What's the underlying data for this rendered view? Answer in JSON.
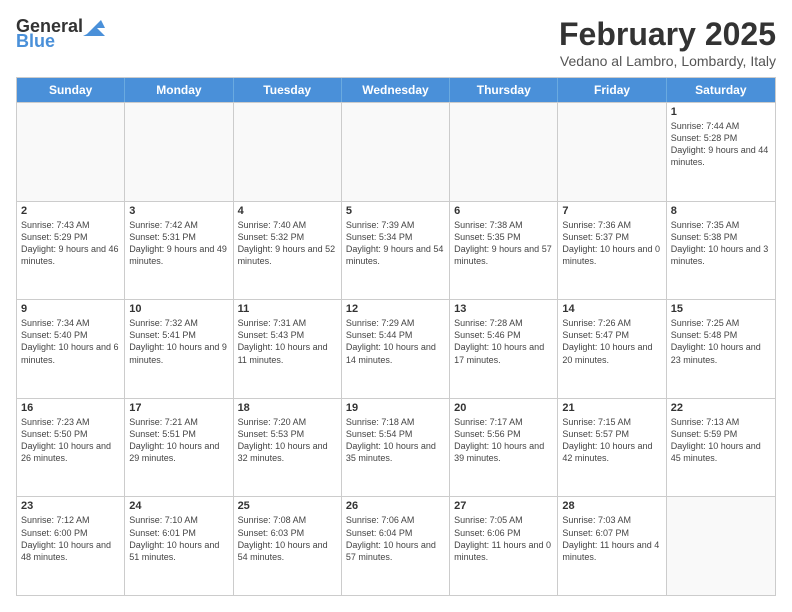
{
  "logo": {
    "general": "General",
    "blue": "Blue"
  },
  "header": {
    "month": "February 2025",
    "location": "Vedano al Lambro, Lombardy, Italy"
  },
  "days_of_week": [
    "Sunday",
    "Monday",
    "Tuesday",
    "Wednesday",
    "Thursday",
    "Friday",
    "Saturday"
  ],
  "weeks": [
    [
      {
        "day": "",
        "info": ""
      },
      {
        "day": "",
        "info": ""
      },
      {
        "day": "",
        "info": ""
      },
      {
        "day": "",
        "info": ""
      },
      {
        "day": "",
        "info": ""
      },
      {
        "day": "",
        "info": ""
      },
      {
        "day": "1",
        "info": "Sunrise: 7:44 AM\nSunset: 5:28 PM\nDaylight: 9 hours and 44 minutes."
      }
    ],
    [
      {
        "day": "2",
        "info": "Sunrise: 7:43 AM\nSunset: 5:29 PM\nDaylight: 9 hours and 46 minutes."
      },
      {
        "day": "3",
        "info": "Sunrise: 7:42 AM\nSunset: 5:31 PM\nDaylight: 9 hours and 49 minutes."
      },
      {
        "day": "4",
        "info": "Sunrise: 7:40 AM\nSunset: 5:32 PM\nDaylight: 9 hours and 52 minutes."
      },
      {
        "day": "5",
        "info": "Sunrise: 7:39 AM\nSunset: 5:34 PM\nDaylight: 9 hours and 54 minutes."
      },
      {
        "day": "6",
        "info": "Sunrise: 7:38 AM\nSunset: 5:35 PM\nDaylight: 9 hours and 57 minutes."
      },
      {
        "day": "7",
        "info": "Sunrise: 7:36 AM\nSunset: 5:37 PM\nDaylight: 10 hours and 0 minutes."
      },
      {
        "day": "8",
        "info": "Sunrise: 7:35 AM\nSunset: 5:38 PM\nDaylight: 10 hours and 3 minutes."
      }
    ],
    [
      {
        "day": "9",
        "info": "Sunrise: 7:34 AM\nSunset: 5:40 PM\nDaylight: 10 hours and 6 minutes."
      },
      {
        "day": "10",
        "info": "Sunrise: 7:32 AM\nSunset: 5:41 PM\nDaylight: 10 hours and 9 minutes."
      },
      {
        "day": "11",
        "info": "Sunrise: 7:31 AM\nSunset: 5:43 PM\nDaylight: 10 hours and 11 minutes."
      },
      {
        "day": "12",
        "info": "Sunrise: 7:29 AM\nSunset: 5:44 PM\nDaylight: 10 hours and 14 minutes."
      },
      {
        "day": "13",
        "info": "Sunrise: 7:28 AM\nSunset: 5:46 PM\nDaylight: 10 hours and 17 minutes."
      },
      {
        "day": "14",
        "info": "Sunrise: 7:26 AM\nSunset: 5:47 PM\nDaylight: 10 hours and 20 minutes."
      },
      {
        "day": "15",
        "info": "Sunrise: 7:25 AM\nSunset: 5:48 PM\nDaylight: 10 hours and 23 minutes."
      }
    ],
    [
      {
        "day": "16",
        "info": "Sunrise: 7:23 AM\nSunset: 5:50 PM\nDaylight: 10 hours and 26 minutes."
      },
      {
        "day": "17",
        "info": "Sunrise: 7:21 AM\nSunset: 5:51 PM\nDaylight: 10 hours and 29 minutes."
      },
      {
        "day": "18",
        "info": "Sunrise: 7:20 AM\nSunset: 5:53 PM\nDaylight: 10 hours and 32 minutes."
      },
      {
        "day": "19",
        "info": "Sunrise: 7:18 AM\nSunset: 5:54 PM\nDaylight: 10 hours and 35 minutes."
      },
      {
        "day": "20",
        "info": "Sunrise: 7:17 AM\nSunset: 5:56 PM\nDaylight: 10 hours and 39 minutes."
      },
      {
        "day": "21",
        "info": "Sunrise: 7:15 AM\nSunset: 5:57 PM\nDaylight: 10 hours and 42 minutes."
      },
      {
        "day": "22",
        "info": "Sunrise: 7:13 AM\nSunset: 5:59 PM\nDaylight: 10 hours and 45 minutes."
      }
    ],
    [
      {
        "day": "23",
        "info": "Sunrise: 7:12 AM\nSunset: 6:00 PM\nDaylight: 10 hours and 48 minutes."
      },
      {
        "day": "24",
        "info": "Sunrise: 7:10 AM\nSunset: 6:01 PM\nDaylight: 10 hours and 51 minutes."
      },
      {
        "day": "25",
        "info": "Sunrise: 7:08 AM\nSunset: 6:03 PM\nDaylight: 10 hours and 54 minutes."
      },
      {
        "day": "26",
        "info": "Sunrise: 7:06 AM\nSunset: 6:04 PM\nDaylight: 10 hours and 57 minutes."
      },
      {
        "day": "27",
        "info": "Sunrise: 7:05 AM\nSunset: 6:06 PM\nDaylight: 11 hours and 0 minutes."
      },
      {
        "day": "28",
        "info": "Sunrise: 7:03 AM\nSunset: 6:07 PM\nDaylight: 11 hours and 4 minutes."
      },
      {
        "day": "",
        "info": ""
      }
    ]
  ]
}
